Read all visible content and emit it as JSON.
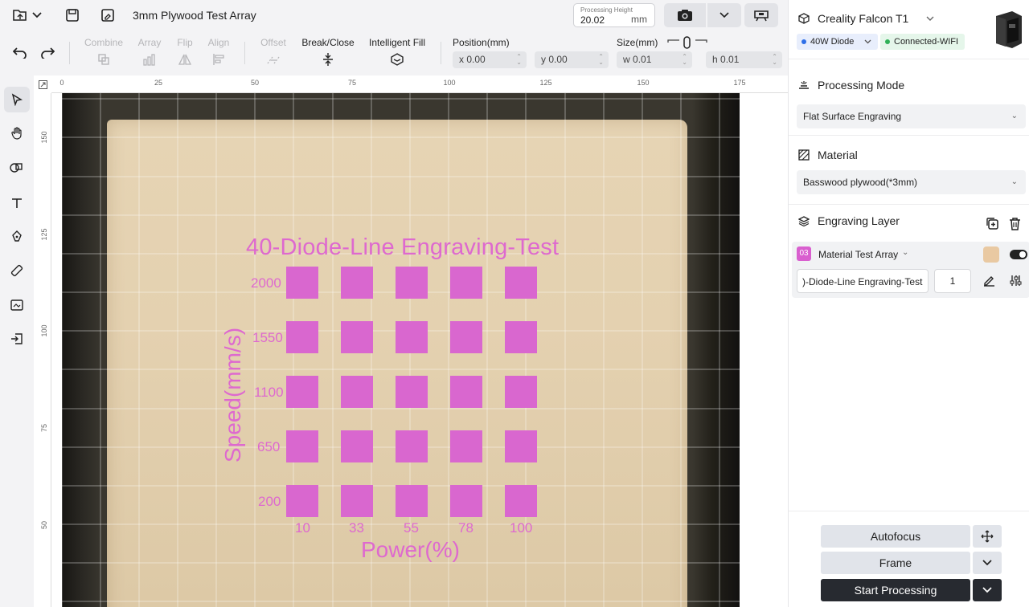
{
  "document": {
    "title": "3mm Plywood Test Array"
  },
  "processing_height": {
    "label": "Processing Height",
    "value": "20.02",
    "unit": "mm"
  },
  "toolbar": {
    "combine": "Combine",
    "array": "Array",
    "flip": "Flip",
    "align": "Align",
    "offset": "Offset",
    "break_close": "Break/Close",
    "intelligent_fill": "Intelligent Fill",
    "position_label": "Position(mm)",
    "x_prefix": "x",
    "x_value": "0.00",
    "y_prefix": "y",
    "y_value": "0.00",
    "size_label": "Size(mm)",
    "w_prefix": "w",
    "w_value": "0.01",
    "h_prefix": "h",
    "h_value": "0.01"
  },
  "rulers": {
    "top": [
      "0",
      "25",
      "50",
      "75",
      "100",
      "125",
      "150",
      "175"
    ],
    "left": [
      "150",
      "125",
      "100",
      "75",
      "50"
    ]
  },
  "design": {
    "title": "40-Diode-Line Engraving-Test",
    "y_axis_title": "Speed(mm/s)",
    "x_axis_title": "Power(%)",
    "speed_labels": [
      "2000",
      "1550",
      "1100",
      "650",
      "200"
    ],
    "power_labels": [
      "10",
      "33",
      "55",
      "78",
      "100"
    ]
  },
  "device": {
    "name": "Creality Falcon T1",
    "laser": "40W Diode",
    "connection": "Connected-WIFI"
  },
  "processing_mode": {
    "heading": "Processing Mode",
    "selected": "Flat Surface Engraving"
  },
  "material": {
    "heading": "Material",
    "selected": "Basswood plywood(*3mm)"
  },
  "engraving_layer": {
    "heading": "Engraving Layer",
    "layer_badge": "03",
    "layer_name": "Material Test Array",
    "layer_color": "#e9c9a2",
    "text_value": ")-Diode-Line Engraving-Test",
    "passes": "1"
  },
  "actions": {
    "autofocus": "Autofocus",
    "frame": "Frame",
    "start": "Start Processing"
  },
  "colors": {
    "design_magenta": "#de69cf",
    "start_button": "#272a30",
    "laser_chip": "#e8eefc",
    "wifi_chip": "#e5f6ea"
  }
}
